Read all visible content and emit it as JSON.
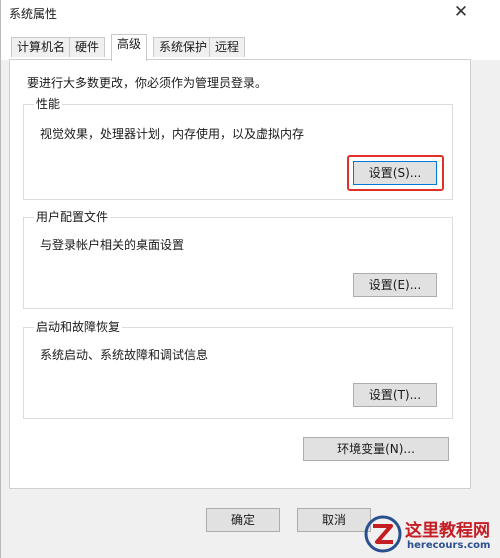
{
  "window": {
    "title": "系统属性",
    "close_glyph": "✕"
  },
  "tabs": [
    {
      "label": "计算机名"
    },
    {
      "label": "硬件"
    },
    {
      "label": "高级",
      "active": true
    },
    {
      "label": "系统保护"
    },
    {
      "label": "远程"
    }
  ],
  "admin_note": "要进行大多数更改，你必须作为管理员登录。",
  "groups": {
    "performance": {
      "title": "性能",
      "desc": "视觉效果，处理器计划，内存使用，以及虚拟内存",
      "button": "设置(S)..."
    },
    "user_profiles": {
      "title": "用户配置文件",
      "desc": "与登录帐户相关的桌面设置",
      "button": "设置(E)..."
    },
    "startup_recovery": {
      "title": "启动和故障恢复",
      "desc": "系统启动、系统故障和调试信息",
      "button": "设置(T)..."
    }
  },
  "env_button": "环境变量(N)...",
  "footer": {
    "ok": "确定",
    "cancel": "取消"
  },
  "watermark": {
    "text": "这里教程网",
    "url": "herecours.com"
  },
  "colors": {
    "highlight": "#e0302a",
    "focus_border": "#0078d7",
    "watermark_red": "#c41d23"
  }
}
